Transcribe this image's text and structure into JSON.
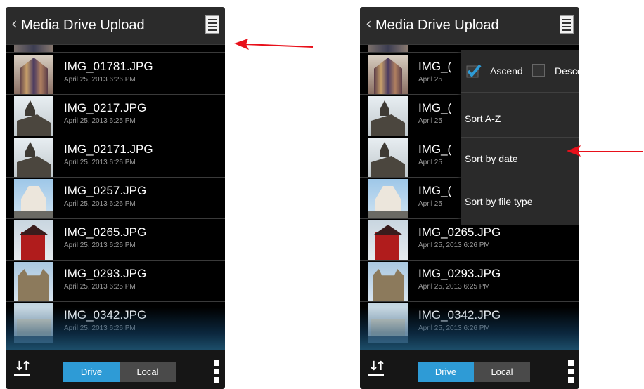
{
  "left_screen": {
    "app_title": "Media Drive Upload",
    "files": [
      {
        "name": "IMG_01781.JPG",
        "date": "April 25, 2013 6:26 PM",
        "thumb": "cathedral"
      },
      {
        "name": "IMG_0217.JPG",
        "date": "April 25, 2013 6:25 PM",
        "thumb": "church"
      },
      {
        "name": "IMG_02171.JPG",
        "date": "April 25, 2013 6:26 PM",
        "thumb": "church"
      },
      {
        "name": "IMG_0257.JPG",
        "date": "April 25, 2013 6:26 PM",
        "thumb": "basilica"
      },
      {
        "name": "IMG_0265.JPG",
        "date": "April 25, 2013 6:26 PM",
        "thumb": "windmill"
      },
      {
        "name": "IMG_0293.JPG",
        "date": "April 25, 2013 6:25 PM",
        "thumb": "abbey"
      },
      {
        "name": "IMG_0342.JPG",
        "date": "April 25, 2013 6:26 PM",
        "thumb": "palace"
      }
    ],
    "bottom": {
      "drive_label": "Drive",
      "local_label": "Local"
    }
  },
  "right_screen": {
    "app_title": "Media Drive Upload",
    "files": [
      {
        "name": "IMG_(",
        "date": "April 25",
        "thumb": "cathedral"
      },
      {
        "name": "IMG_(",
        "date": "April 25",
        "thumb": "church"
      },
      {
        "name": "IMG_(",
        "date": "April 25",
        "thumb": "church"
      },
      {
        "name": "IMG_(",
        "date": "April 25",
        "thumb": "basilica"
      },
      {
        "name": "IMG_0265.JPG",
        "date": "April 25, 2013 6:26 PM",
        "thumb": "windmill"
      },
      {
        "name": "IMG_0293.JPG",
        "date": "April 25, 2013 6:25 PM",
        "thumb": "abbey"
      },
      {
        "name": "IMG_0342.JPG",
        "date": "April 25, 2013 6:26 PM",
        "thumb": "palace"
      }
    ],
    "sort_menu": {
      "ascend_label": "Ascend",
      "ascend_checked": true,
      "descend_label": "Descend",
      "descend_checked": false,
      "items": [
        "Sort A-Z",
        "Sort by date",
        "Sort by file type"
      ]
    },
    "bottom": {
      "drive_label": "Drive",
      "local_label": "Local"
    }
  },
  "colors": {
    "accent": "#2e9bd6",
    "annotation_arrow": "#e8101a"
  }
}
